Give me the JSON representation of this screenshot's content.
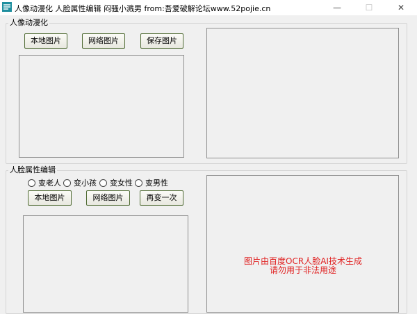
{
  "window": {
    "title": "人像动漫化 人脸属性编辑 闷骚小溅男 from:吾爱破解论坛www.52pojie.cn",
    "min_glyph": "—",
    "max_glyph": "☐",
    "close_glyph": "✕"
  },
  "anime_group": {
    "label": "人像动漫化",
    "local_image_button": "本地图片",
    "web_image_button": "网络图片",
    "save_image_button": "保存图片"
  },
  "face_group": {
    "label": "人脸属性编辑",
    "radios": [
      {
        "label": "变老人",
        "checked": false
      },
      {
        "label": "变小孩",
        "checked": false
      },
      {
        "label": "变女性",
        "checked": false
      },
      {
        "label": "变男性",
        "checked": false
      }
    ],
    "local_image_button": "本地图片",
    "web_image_button": "网络图片",
    "retry_button": "再变一次"
  },
  "notice": {
    "line1": "图片由百度OCR人脸AI技术生成",
    "line2": "请勿用于非法用途"
  },
  "colors": {
    "notice": "#e02020",
    "button_border": "#4f6b33",
    "icon_accent": "#1f8f9f"
  }
}
